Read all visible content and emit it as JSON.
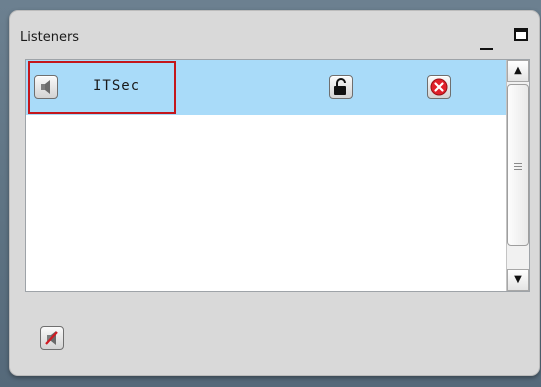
{
  "panel": {
    "title": "Listeners"
  },
  "listeners": [
    {
      "name": "ITSec",
      "icon": "speaker-icon",
      "lock_icon": "unlock-icon",
      "remove_icon": "remove-icon"
    }
  ],
  "footer": {
    "mute_icon": "mute-all-icon"
  },
  "colors": {
    "selected_row": "#a9dbf9",
    "highlight_border": "#c4161c",
    "remove_red": "#e0202a"
  }
}
